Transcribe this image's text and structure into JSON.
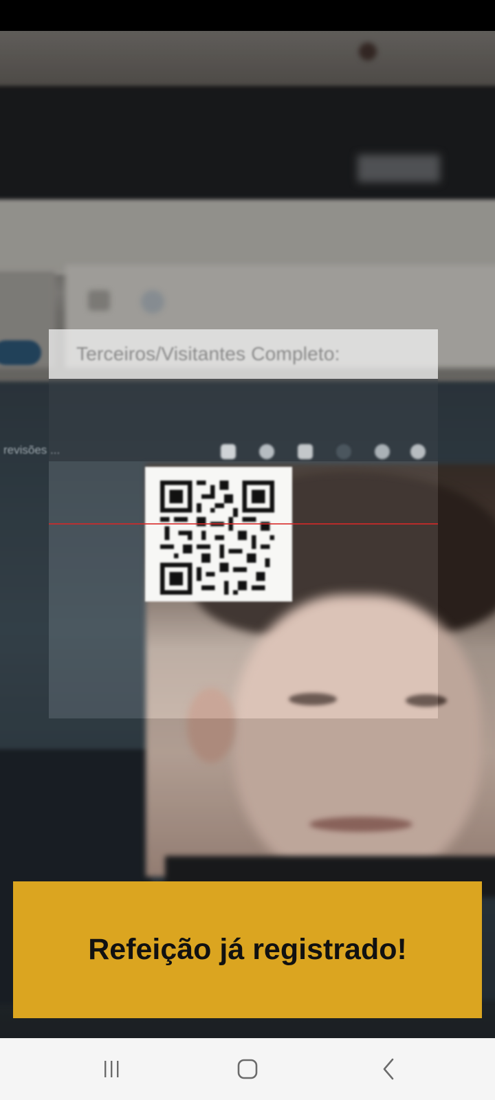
{
  "scanner": {
    "frame_title": "Terceiros/Visitantes Completo:",
    "side_label": "revisões ..."
  },
  "message": {
    "text": "Refeição já registrado!",
    "background_color": "#dba520"
  },
  "nav": {
    "recents_icon": "recents-icon",
    "home_icon": "home-icon",
    "back_icon": "back-icon"
  }
}
